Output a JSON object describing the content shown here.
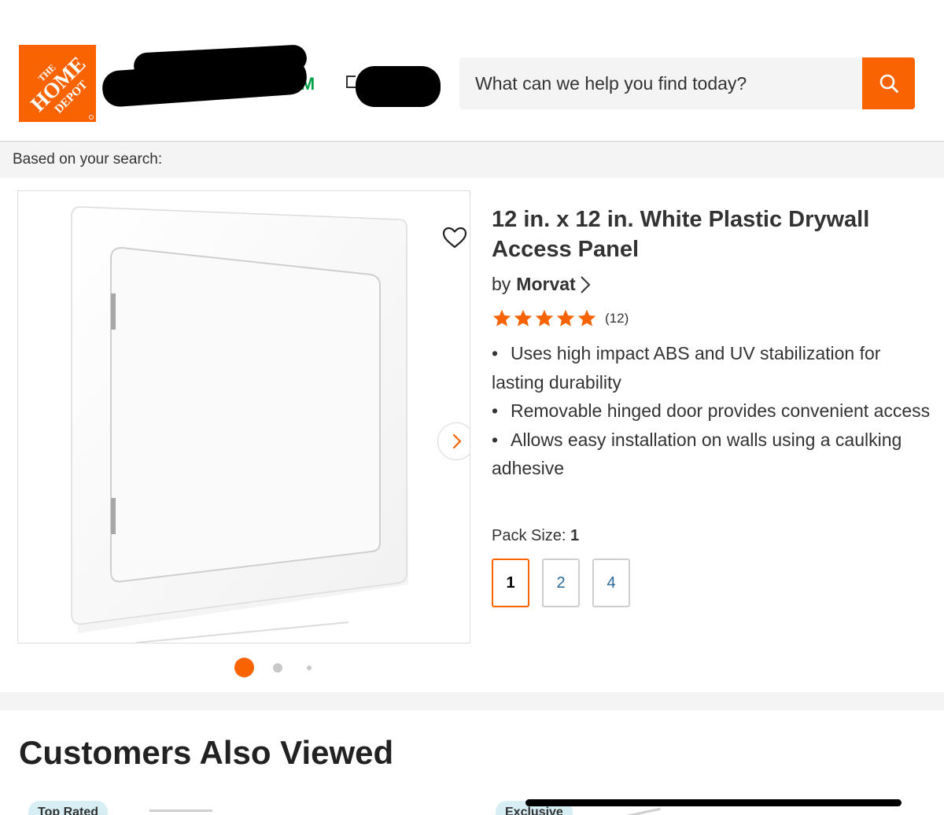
{
  "header": {
    "logo_text": "THE HOME DEPOT",
    "store_time": "3PM",
    "search": {
      "placeholder": "What can we help you find today?",
      "icon": "search-icon"
    }
  },
  "search_context": "Based on your search:",
  "product": {
    "title": "12 in. x 12 in. White Plastic Drywall Access Panel",
    "brand_prefix": "by",
    "brand": "Morvat",
    "rating_count": "(12)",
    "stars": 5,
    "bullets": [
      "Uses high impact ABS and UV stabilization for lasting durability",
      "Removable hinged door provides convenient access",
      "Allows easy installation on walls using a caulking adhesive"
    ],
    "pack_size_label": "Pack Size:",
    "pack_size_value": "1",
    "pack_options": [
      "1",
      "2",
      "4"
    ],
    "selected_pack": "1",
    "image_count": 3,
    "current_image": 1
  },
  "also_viewed": {
    "title": "Customers Also Viewed",
    "badges": [
      "Top Rated",
      "Exclusive"
    ]
  },
  "colors": {
    "brand_orange": "#f96302",
    "store_green": "#00a34a",
    "link_blue": "#2b6a98"
  }
}
